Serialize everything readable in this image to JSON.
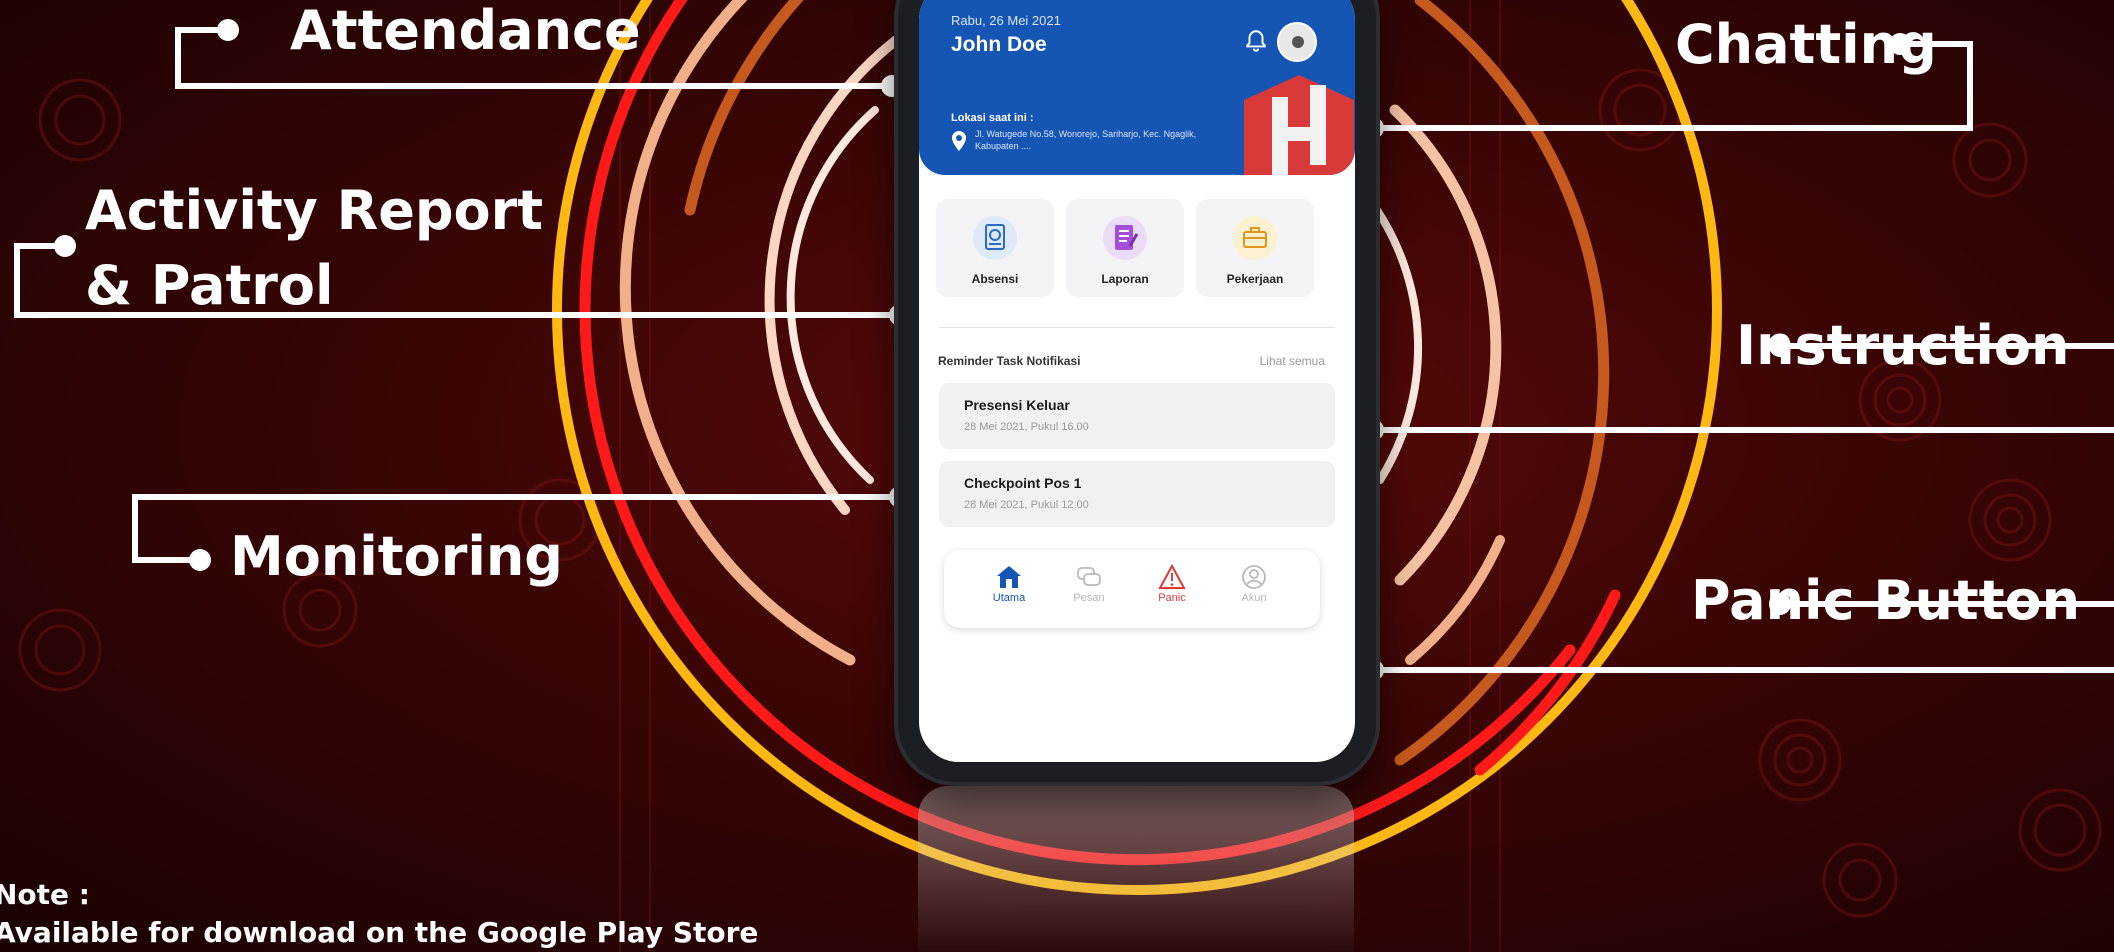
{
  "callouts": {
    "attendance": "Attendance",
    "activity_line1": "Activity Report",
    "activity_line2": "& Patrol",
    "monitoring": "Monitoring",
    "chatting": "Chatting",
    "instruction": "Instruction",
    "panic_button": "Panic Button"
  },
  "note": {
    "line1": "Note :",
    "line2": "Available for download on the Google Play Store"
  },
  "app": {
    "date": "Rabu, 26 Mei 2021",
    "user_name": "John Doe",
    "location_label": "Lokasi saat ini :",
    "location_text": "Jl. Watugede No.58, Wonorejo, Sariharjo, Kec. Ngaglik, Kabupaten ....",
    "menu": [
      {
        "label": "Absensi",
        "icon": "attendance-document-icon"
      },
      {
        "label": "Laporan",
        "icon": "report-notebook-icon"
      },
      {
        "label": "Pekerjaan",
        "icon": "briefcase-icon"
      }
    ],
    "reminder_title": "Reminder Task Notifikasi",
    "see_all": "Lihat semua",
    "tasks": [
      {
        "title": "Presensi Keluar",
        "date": "28 Mei 2021, Pukul 16.00"
      },
      {
        "title": "Checkpoint Pos 1",
        "date": "28 Mei 2021, Pukul 12.00"
      }
    ],
    "nav": [
      {
        "label": "Utama",
        "icon": "home-icon",
        "color": "#1556b4"
      },
      {
        "label": "Pesan",
        "icon": "chat-icon",
        "color": "#b9b9b9"
      },
      {
        "label": "Panic",
        "icon": "warning-icon",
        "color": "#e03a3a"
      },
      {
        "label": "Akun",
        "icon": "account-icon",
        "color": "#b9b9b9"
      }
    ]
  },
  "colors": {
    "ring_yellow": "#fdb813",
    "ring_red": "#ff1a1a",
    "ring_orange": "#c65a1e",
    "ring_peach": "#f2b08a",
    "ring_light": "#fde6d8",
    "header_blue": "#1556b4"
  }
}
